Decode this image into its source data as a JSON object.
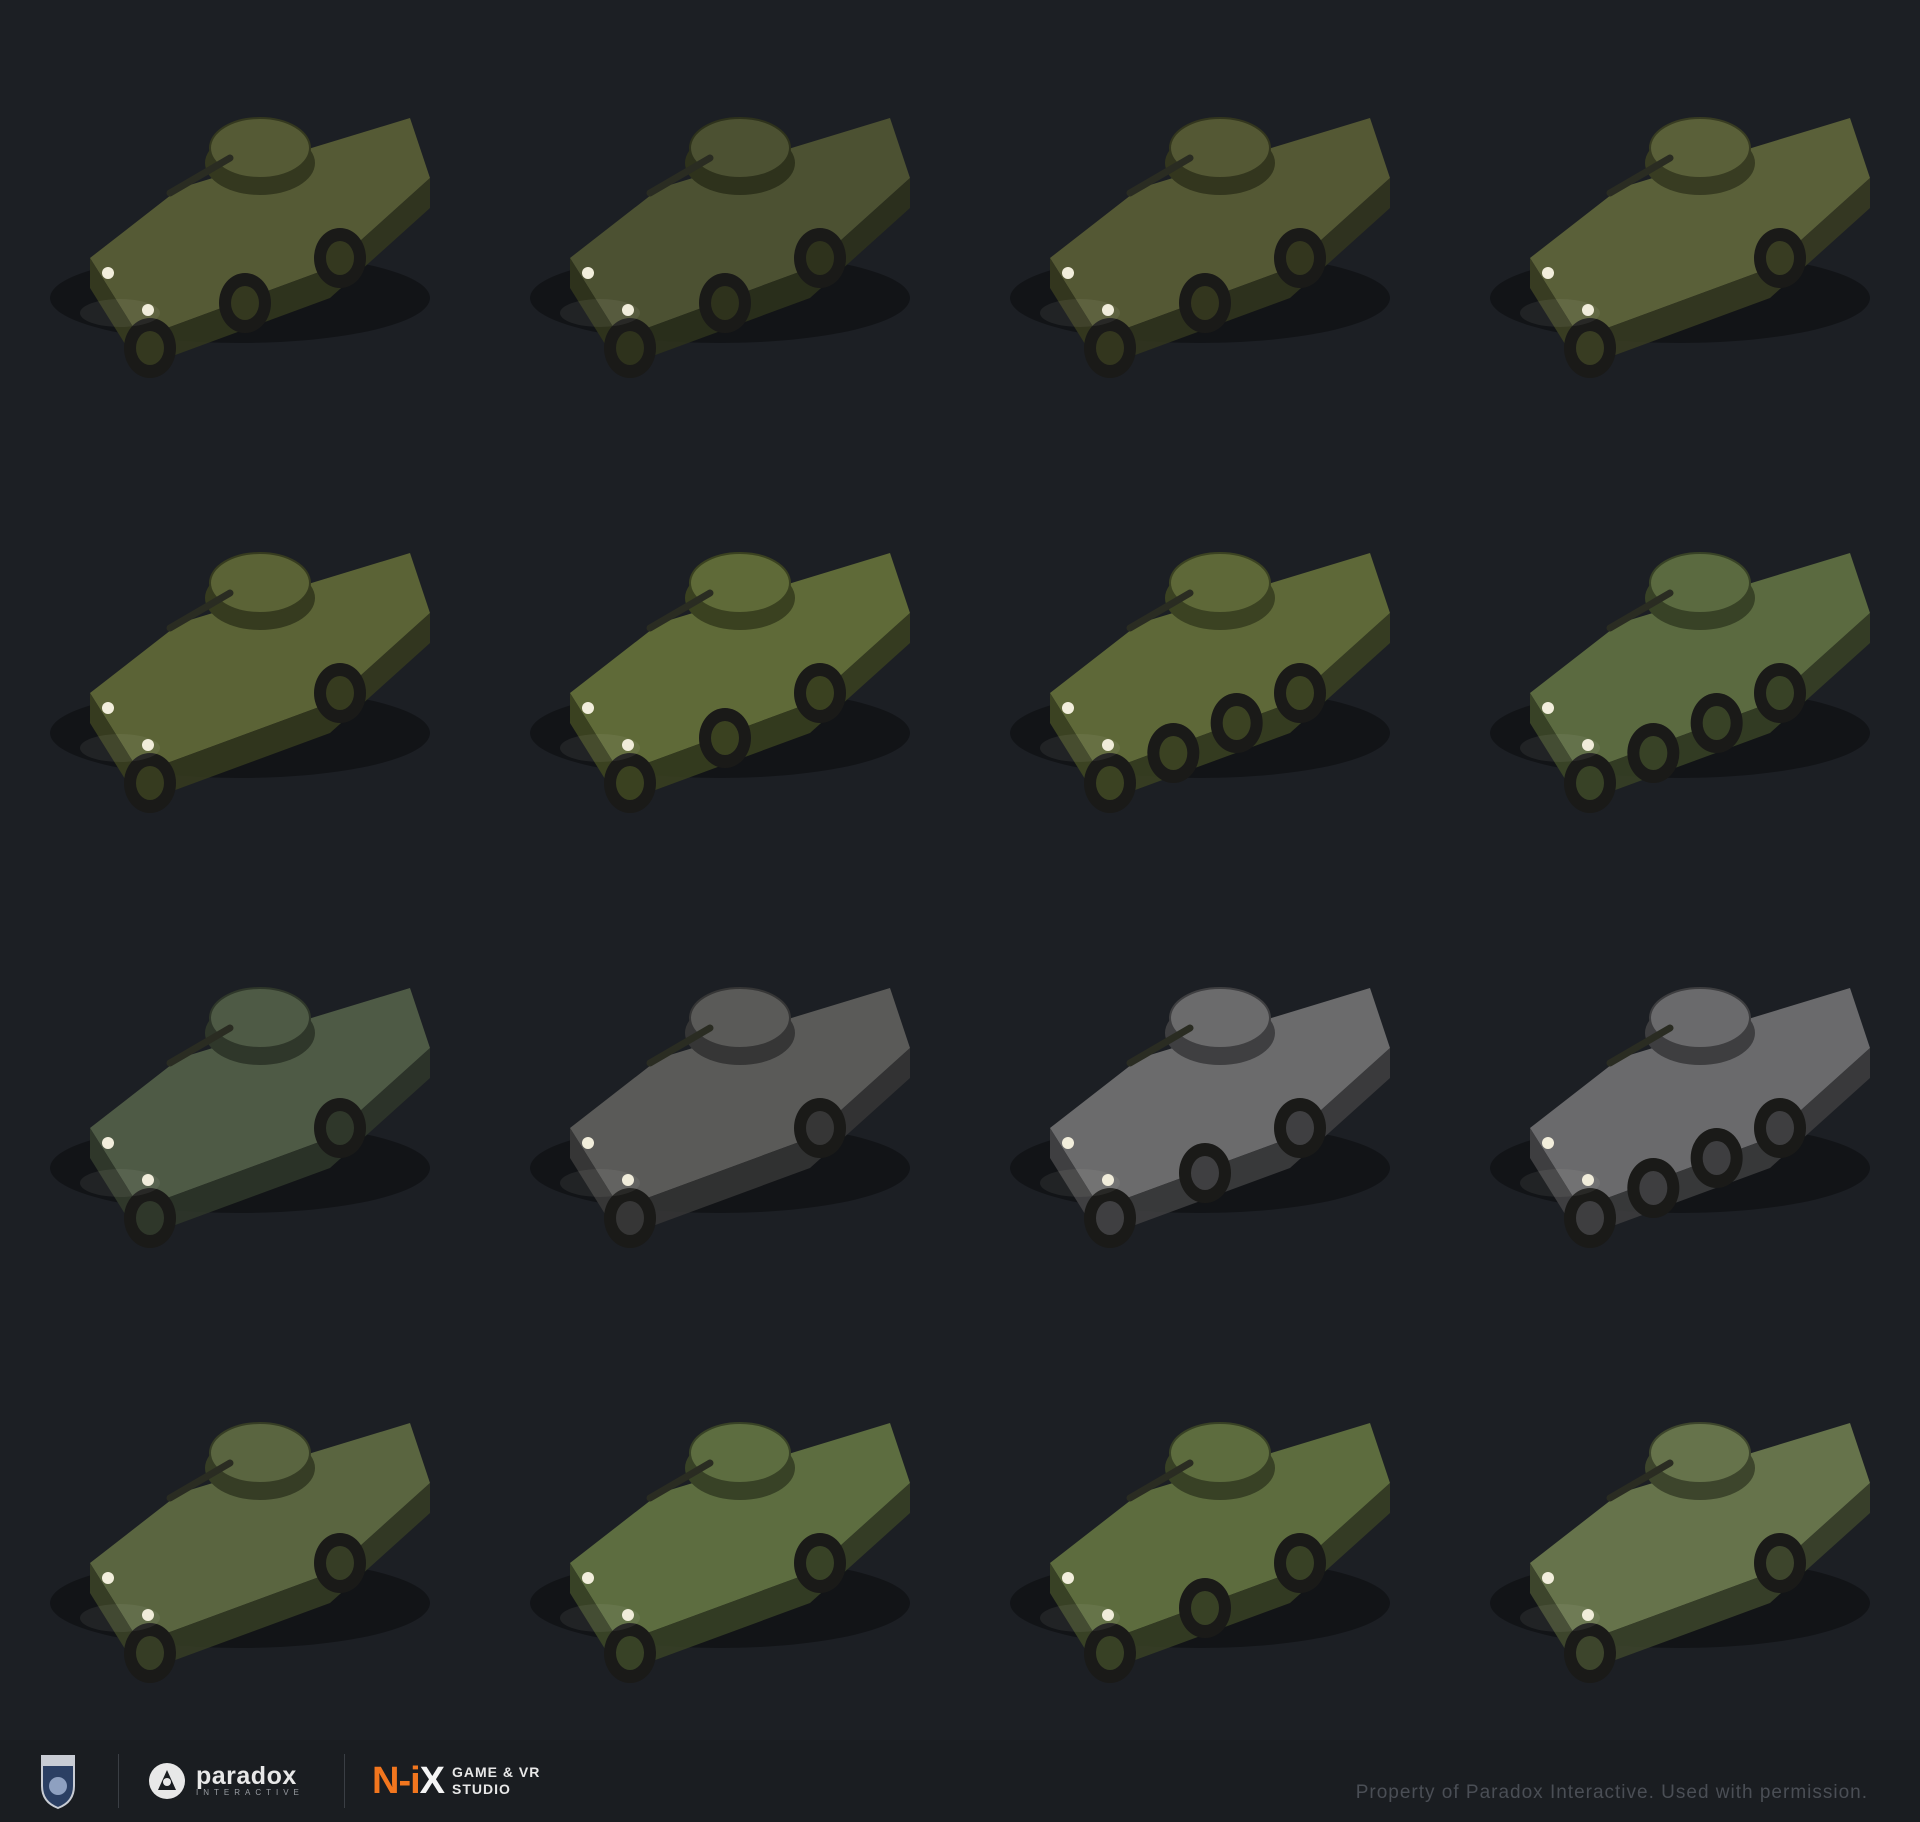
{
  "gallery": {
    "vehicles": [
      {
        "color": "#555a35",
        "dark": "#34381f",
        "wheels": 3
      },
      {
        "color": "#4c5132",
        "dark": "#2e321c",
        "wheels": 3
      },
      {
        "color": "#545834",
        "dark": "#33361e",
        "wheels": 3
      },
      {
        "color": "#5a6039",
        "dark": "#383c22",
        "wheels": 2
      },
      {
        "color": "#5b6336",
        "dark": "#363b1f",
        "wheels": 2
      },
      {
        "color": "#5f6a38",
        "dark": "#3a4120",
        "wheels": 3
      },
      {
        "color": "#5e6838",
        "dark": "#3b4222",
        "wheels": 4
      },
      {
        "color": "#5b6a40",
        "dark": "#384226",
        "wheels": 4
      },
      {
        "color": "#4e5a45",
        "dark": "#2f372a",
        "wheels": 2
      },
      {
        "color": "#5a5a58",
        "dark": "#363636",
        "wheels": 2
      },
      {
        "color": "#6b6b6c",
        "dark": "#3f3f41",
        "wheels": 3
      },
      {
        "color": "#6a6a6c",
        "dark": "#3e3e40",
        "wheels": 4
      },
      {
        "color": "#5a6540",
        "dark": "#363d25",
        "wheels": 2
      },
      {
        "color": "#5d6d40",
        "dark": "#384226",
        "wheels": 2
      },
      {
        "color": "#5d6c3e",
        "dark": "#384125",
        "wheels": 3
      },
      {
        "color": "#66734b",
        "dark": "#3d452c",
        "wheels": 2
      }
    ]
  },
  "footer": {
    "paradox_word": "paradox",
    "paradox_sub": "INTERACTIVE",
    "nix_prefix": "N-i",
    "nix_x": "X",
    "nix_line1": "GAME & VR",
    "nix_line2": "STUDIO",
    "credit": "Property of Paradox Interactive. Used with permission."
  }
}
